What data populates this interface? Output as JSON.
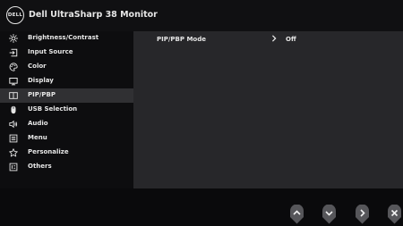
{
  "header": {
    "logo_text": "DELL",
    "title": "Dell UltraSharp 38 Monitor"
  },
  "sidebar": {
    "items": [
      {
        "label": "Brightness/Contrast",
        "icon": "sun-icon",
        "selected": false
      },
      {
        "label": "Input Source",
        "icon": "input-source-icon",
        "selected": false
      },
      {
        "label": "Color",
        "icon": "palette-icon",
        "selected": false
      },
      {
        "label": "Display",
        "icon": "monitor-icon",
        "selected": false
      },
      {
        "label": "PIP/PBP",
        "icon": "pip-pbp-icon",
        "selected": true
      },
      {
        "label": "USB Selection",
        "icon": "mouse-icon",
        "selected": false
      },
      {
        "label": "Audio",
        "icon": "speaker-icon",
        "selected": false
      },
      {
        "label": "Menu",
        "icon": "menu-list-icon",
        "selected": false
      },
      {
        "label": "Personalize",
        "icon": "star-icon",
        "selected": false
      },
      {
        "label": "Others",
        "icon": "info-icon",
        "selected": false
      }
    ]
  },
  "panel": {
    "setting_label": "PIP/PBP Mode",
    "setting_value": "Off"
  },
  "footer": {
    "buttons": [
      {
        "icon": "up-arrow-icon"
      },
      {
        "icon": "down-arrow-icon"
      },
      {
        "icon": "right-arrow-icon"
      },
      {
        "icon": "close-icon"
      }
    ]
  },
  "colors": {
    "background": "#0d0d0f",
    "content_panel": "#27272a",
    "selected_item": "#303033",
    "text": "#e6e6e6",
    "hw_button": "#56565a"
  }
}
